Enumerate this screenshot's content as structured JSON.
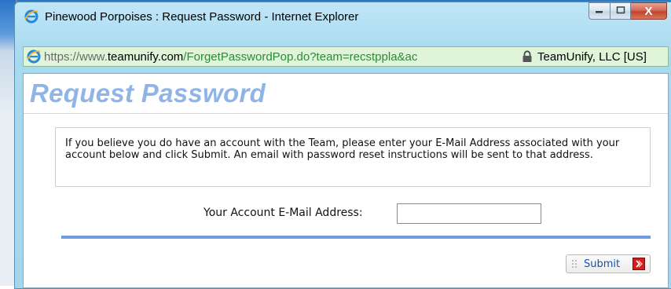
{
  "window": {
    "title": "Pinewood Porpoises : Request Password - Internet Explorer",
    "controls": {
      "minimize": "–",
      "maximize": "□",
      "close": "X"
    }
  },
  "address_bar": {
    "url_prefix": "https://www.",
    "url_domain": "teamunify.com",
    "url_rest": "/ForgetPasswordPop.do?team=recstppla&ac",
    "certificate": "TeamUnify, LLC [US]"
  },
  "page": {
    "heading": "Request Password",
    "info_text": "If you believe you do have an account with the Team, please enter your E-Mail Address associated with your account below and click Submit. An email with password reset instructions will be sent to that address.",
    "email_label": "Your Account E-Mail Address:",
    "email_value": "",
    "submit_label": "Submit"
  },
  "colors": {
    "heading": "#8fb4e8",
    "divider": "#6b9be0",
    "address_bar_secure": "#dff4d9",
    "close_button": "#c2432b"
  },
  "icons": [
    "ie-icon",
    "ie-address-icon",
    "lock-icon",
    "submit-arrow-icon"
  ]
}
